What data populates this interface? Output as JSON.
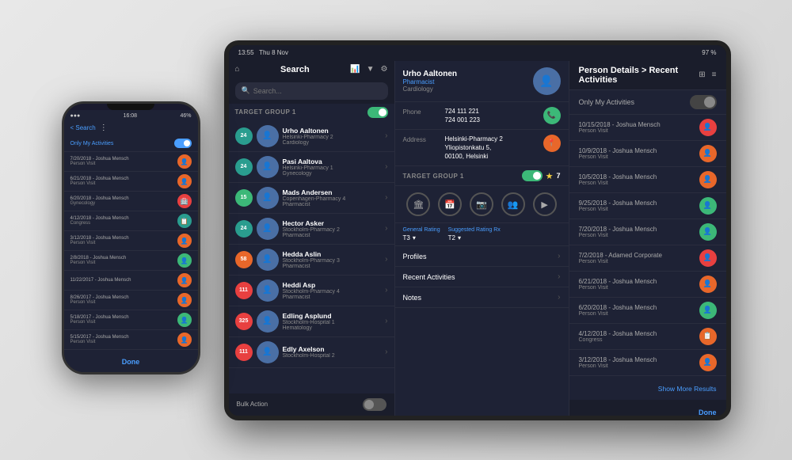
{
  "scene": {
    "bg_color": "#e0e0e0"
  },
  "phone": {
    "status": {
      "time": "16:08",
      "battery": "46%",
      "signal": "●●●"
    },
    "header": {
      "back_label": "< Search",
      "menu_icon": "⋮"
    },
    "toggle_row": {
      "label": "Only My Activities",
      "toggle_state": "on"
    },
    "activities": [
      {
        "date": "7/20/2018 - Joshua Mensch",
        "type": "Person Visit",
        "icon_color": "orange",
        "icon": "👤"
      },
      {
        "date": "6/21/2018 - Joshua Mensch",
        "type": "Person Visit",
        "icon_color": "orange",
        "icon": "👤"
      },
      {
        "date": "6/20/2018 - Joshua Mensch",
        "type": "Gynecology",
        "icon_color": "red",
        "icon": "🏥"
      },
      {
        "date": "4/12/2018 - Joshua Mensch",
        "type": "Congress",
        "icon_color": "teal",
        "icon": "📋"
      },
      {
        "date": "3/12/2018 - Joshua Mensch",
        "type": "Person Visit",
        "icon_color": "orange",
        "icon": "👤"
      },
      {
        "date": "2/8/2018 - Joshua Mensch",
        "type": "Person Visit",
        "icon_color": "green",
        "icon": "👤"
      },
      {
        "date": "11/22/2017 - Joshua Mensch",
        "type": "",
        "icon_color": "orange",
        "icon": "👤"
      },
      {
        "date": "8/26/2017 - Joshua Mensch",
        "type": "Person Visit",
        "icon_color": "orange",
        "icon": "👤"
      },
      {
        "date": "5/18/2017 - Joshua Mensch",
        "type": "Person Visit",
        "icon_color": "green",
        "icon": "👤"
      },
      {
        "date": "5/15/2017 - Joshua Mensch",
        "type": "Person Visit",
        "icon_color": "orange",
        "icon": "👤"
      }
    ],
    "footer": {
      "done_label": "Done"
    }
  },
  "tablet": {
    "status_bar": {
      "time": "13:55",
      "date": "Thu 8 Nov",
      "battery": "97 %",
      "signal": "●●●●"
    },
    "search_panel": {
      "title": "Search",
      "search_placeholder": "Search...",
      "target_group_label": "TARGET GROUP 1",
      "contacts": [
        {
          "name": "Urho Aaltonen",
          "sub1": "Helsinki-Pharmacy 2",
          "sub2": "Cardiology",
          "badge": "24",
          "badge_color": "teal"
        },
        {
          "name": "Pasi Aaltova",
          "sub1": "Helsinki-Pharmacy 1",
          "sub2": "Gynecology",
          "badge": "24",
          "badge_color": "teal"
        },
        {
          "name": "Mads Andersen",
          "sub1": "Copenhagen-Pharmacy 4",
          "sub2": "Pharmacist",
          "badge": "15",
          "badge_color": "green"
        },
        {
          "name": "Hector Asker",
          "sub1": "Stockholm-Pharmacy 2",
          "sub2": "Pharmacist",
          "badge": "24",
          "badge_color": "teal"
        },
        {
          "name": "Hedda Aslin",
          "sub1": "Stockholm-Pharmacy 3",
          "sub2": "Pharmacist",
          "badge": "58",
          "badge_color": "orange"
        },
        {
          "name": "Heddi Asp",
          "sub1": "Stockholm-Pharmacy 4",
          "sub2": "Pharmacist",
          "badge": "111",
          "badge_color": "red"
        },
        {
          "name": "Edling Asplund",
          "sub1": "Stockholm-Hospital 1",
          "sub2": "Hematology",
          "badge": "325",
          "badge_color": "red"
        },
        {
          "name": "Edly Axelson",
          "sub1": "Stockholm-Hospital 2",
          "sub2": "",
          "badge": "111",
          "badge_color": "red"
        }
      ],
      "bulk_action_label": "Bulk Action"
    },
    "detail_panel": {
      "person": {
        "name": "Urho Aaltonen",
        "role": "Pharmacist",
        "specialty": "Cardiology"
      },
      "phone": {
        "label": "Phone",
        "value1": "724 111 221",
        "value2": "724 001 223"
      },
      "address": {
        "label": "Address",
        "value": "Helsinki-Pharmacy 2\nYliopistonkatu 5,\n00100, Helsinki"
      },
      "target_group": {
        "label": "TARGET GROUP 1",
        "star_count": "7"
      },
      "rating": {
        "general_label": "General Rating",
        "general_value": "T3",
        "suggested_label": "Suggested Rating Rx",
        "suggested_value": "T2"
      },
      "menu_items": [
        {
          "label": "Profiles"
        },
        {
          "label": "Recent Activities"
        },
        {
          "label": "Notes"
        }
      ]
    },
    "activities_panel": {
      "title": "Person Details > Recent Activities",
      "toggle_label": "Only My Activities",
      "activities": [
        {
          "date": "10/15/2018 - Joshua Mensch",
          "type": "Person Visit",
          "icon_color": "red"
        },
        {
          "date": "10/9/2018 - Joshua Mensch",
          "type": "Person Visit",
          "icon_color": "orange"
        },
        {
          "date": "10/5/2018 - Joshua Mensch",
          "type": "Person Visit",
          "icon_color": "orange"
        },
        {
          "date": "9/25/2018 - Joshua Mensch",
          "type": "Person Visit",
          "icon_color": "green"
        },
        {
          "date": "7/20/2018 - Joshua Mensch",
          "type": "Person Visit",
          "icon_color": "green"
        },
        {
          "date": "7/2/2018 - Adamed Corporate",
          "type": "Person Visit",
          "icon_color": "red"
        },
        {
          "date": "6/21/2018 - Joshua Mensch",
          "type": "Person Visit",
          "icon_color": "orange"
        },
        {
          "date": "6/20/2018 - Joshua Mensch",
          "type": "Person Visit",
          "icon_color": "green"
        },
        {
          "date": "4/12/2018 - Joshua Mensch",
          "type": "Congress",
          "icon_color": "orange"
        },
        {
          "date": "3/12/2018 - Joshua Mensch",
          "type": "Person Visit",
          "icon_color": "orange"
        }
      ],
      "show_more_label": "Show More Results",
      "done_label": "Done"
    }
  }
}
